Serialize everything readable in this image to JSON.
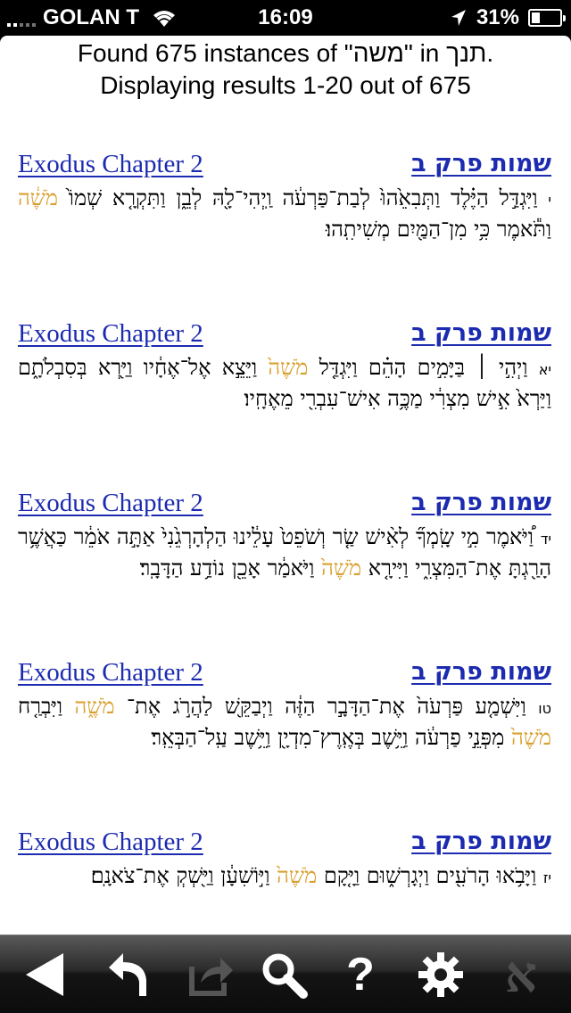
{
  "status_bar": {
    "carrier": "GOLAN T",
    "time": "16:09",
    "battery_percent": "31%",
    "battery_level": 0.31
  },
  "summary": {
    "line1": "Found 675 instances of \"משה\" in תנך.",
    "line2": "Displaying results 1-20 out of 675"
  },
  "results": [
    {
      "en_title": "Exodus Chapter 2",
      "he_title": "שמות פרק ב",
      "verse_num": "י",
      "text_before": "וַיִּגְדַּ֣ל הַיֶּ֗לֶד וַתְּבִאֵ֙הוּ֙ לְבַת־פַּרְעֹ֔ה וַֽיְהִי־לָ֖הּ לְבֵ֑ן וַתִּקְרָ֤א שְׁמוֹ֙",
      "highlight": "מֹשֶׁ֔ה",
      "text_after": "וַתֹּ֕אמֶר כִּ֥י מִן־הַמַּ֖יִם מְשִׁיתִֽהוּ׃"
    },
    {
      "en_title": "Exodus Chapter 2",
      "he_title": "שמות פרק ב",
      "verse_num": "יא",
      "text_before": "וַיְהִ֣י ׀ בַּיָּמִ֣ים הָהֵ֗ם וַיִּגְדַּ֤ל",
      "highlight": "מֹשֶׁה֙",
      "text_after": "וַיֵּצֵ֣א אֶל־אֶחָ֔יו וַיַּ֖רְא בְּסִבְלֹתָ֑ם וַיַּרְא֙ אִ֣ישׁ מִצְרִ֔י מַכֶּ֥ה אִישׁ־עִבְרִ֖י מֵאֶחָֽיו׃"
    },
    {
      "en_title": "Exodus Chapter 2",
      "he_title": "שמות פרק ב",
      "verse_num": "יד",
      "text_before": "וַ֠יֹּאמֶר מִ֣י שָֽׂמְךָ֞ לְאִ֨ישׁ שַׂ֤ר וְשֹׁפֵט֙ עָלֵ֔ינוּ הַלְהָרְגֵ֙נִי֙ אַתָּ֣ה אֹמֵ֔ר כַּאֲשֶׁ֥ר הָרַ֖גְתָּ אֶת־הַמִּצְרִ֑י וַיִּירָ֤א",
      "highlight": "מֹשֶׁה֙",
      "text_after": "וַיֹּאמַ֔ר אָכֵ֖ן נוֹדַ֥ע הַדָּבָֽר׃"
    },
    {
      "en_title": "Exodus Chapter 2",
      "he_title": "שמות פרק ב",
      "verse_num": "טו",
      "text_before": "וַיִּשְׁמַ֤ע פַּרְעֹה֙ אֶת־הַדָּבָ֣ר הַזֶּ֔ה וַיְבַקֵּ֖שׁ לַהֲרֹ֣ג אֶת־",
      "highlight": "מֹשֶׁ֑ה",
      "text_mid": "וַיִּבְרַ֤ח",
      "highlight2": "מֹשֶׁה֙",
      "text_after": "מִפְּנֵ֣י פַרְעֹ֔ה וַיֵּ֥שֶׁב בְּאֶֽרֶץ־מִדְיָ֖ן וַיֵּ֥שֶׁב עַֽל־הַבְּאֵֽר׃"
    },
    {
      "en_title": "Exodus Chapter 2",
      "he_title": "שמות פרק ב",
      "verse_num": "יז",
      "text_before": "וַיָּבֹ֥אוּ הָרֹעִ֖ים וַיְגָרְשׁ֑וּם וַיָּ֤קָם",
      "highlight": "מֹשֶׁה֙",
      "text_after": "וַיּ֣וֹשִׁעָ֔ן וַיַּ֖שְׁקְ אֶת־צֹאנָֽם׃"
    }
  ],
  "toolbar": {
    "aleph": "א",
    "help": "?"
  },
  "icons": {
    "back": "back-triangle-icon",
    "return": "return-arrow-icon",
    "share": "share-icon",
    "search": "search-icon",
    "help": "help-icon",
    "settings": "gear-icon",
    "language": "aleph-icon"
  },
  "colors": {
    "link": "#1c2bb0",
    "highlight": "#d9a030"
  }
}
